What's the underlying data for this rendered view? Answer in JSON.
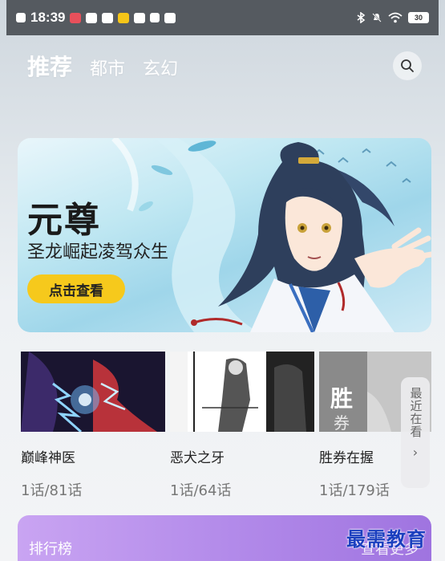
{
  "status_bar": {
    "time": "18:39",
    "battery": "30"
  },
  "tabs": [
    {
      "label": "推荐",
      "active": true
    },
    {
      "label": "都市",
      "active": false
    },
    {
      "label": "玄幻",
      "active": false
    }
  ],
  "banner": {
    "title": "元尊",
    "subtitle": "圣龙崛起凌驾众生",
    "cta": "点击查看"
  },
  "comics": [
    {
      "name": "巅峰神医",
      "episodes": "1话/81话"
    },
    {
      "name": "恶犬之牙",
      "episodes": "1话/64话"
    },
    {
      "name": "胜券在握",
      "episodes": "1话/179话"
    }
  ],
  "recent": {
    "label": "最近在看",
    "icon": "chevron-right-icon"
  },
  "ranking": {
    "label": "排行榜",
    "more": "查看更多"
  },
  "watermark": "最需教育",
  "colors": {
    "accent_yellow": "#f6c91c",
    "ranking_purple": "#b38bea",
    "watermark_blue": "#1b3fbf"
  }
}
